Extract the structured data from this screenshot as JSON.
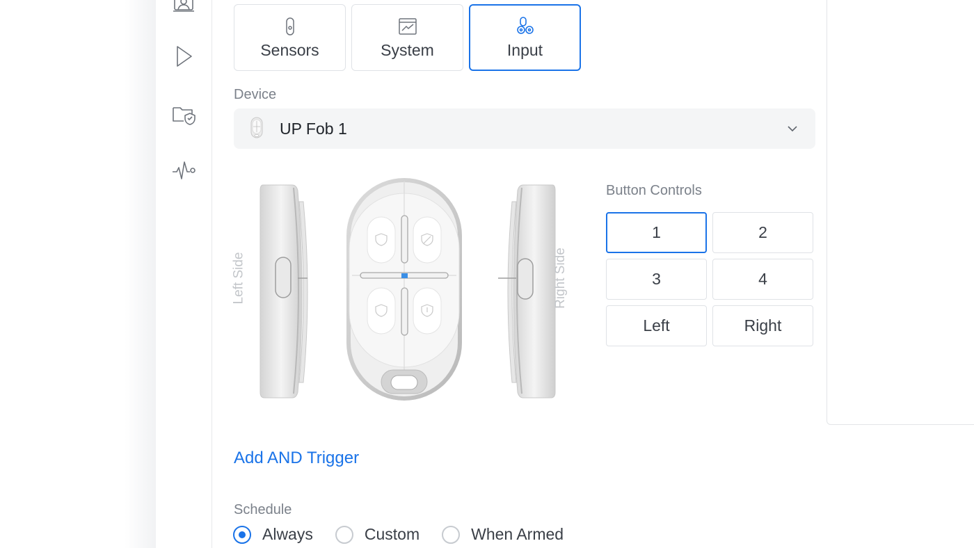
{
  "colors": {
    "accent": "#1a73e8",
    "border": "#dfe2e6",
    "muted_text": "#7b818a",
    "select_bg": "#f4f5f6"
  },
  "sidebar": {
    "icons": [
      {
        "name": "camera-user-icon"
      },
      {
        "name": "play-icon"
      },
      {
        "name": "folder-shield-icon"
      },
      {
        "name": "activity-pulse-icon"
      }
    ]
  },
  "tabs": [
    {
      "label": "Sensors",
      "icon": "sensor-icon",
      "active": false
    },
    {
      "label": "System",
      "icon": "system-chart-icon",
      "active": false
    },
    {
      "label": "Input",
      "icon": "input-fob-icon",
      "active": true
    }
  ],
  "device": {
    "label": "Device",
    "selected": "UP Fob 1",
    "icon": "fob-mini-icon"
  },
  "fob": {
    "left_side_label": "Left Side",
    "right_side_label": "Right Side"
  },
  "button_controls": {
    "label": "Button Controls",
    "buttons": [
      {
        "label": "1",
        "active": true
      },
      {
        "label": "2",
        "active": false
      },
      {
        "label": "3",
        "active": false
      },
      {
        "label": "4",
        "active": false
      },
      {
        "label": "Left",
        "active": false
      },
      {
        "label": "Right",
        "active": false
      }
    ]
  },
  "add_trigger": {
    "label": "Add AND Trigger"
  },
  "schedule": {
    "label": "Schedule",
    "options": [
      {
        "label": "Always",
        "checked": true
      },
      {
        "label": "Custom",
        "checked": false
      },
      {
        "label": "When Armed",
        "checked": false
      }
    ]
  }
}
